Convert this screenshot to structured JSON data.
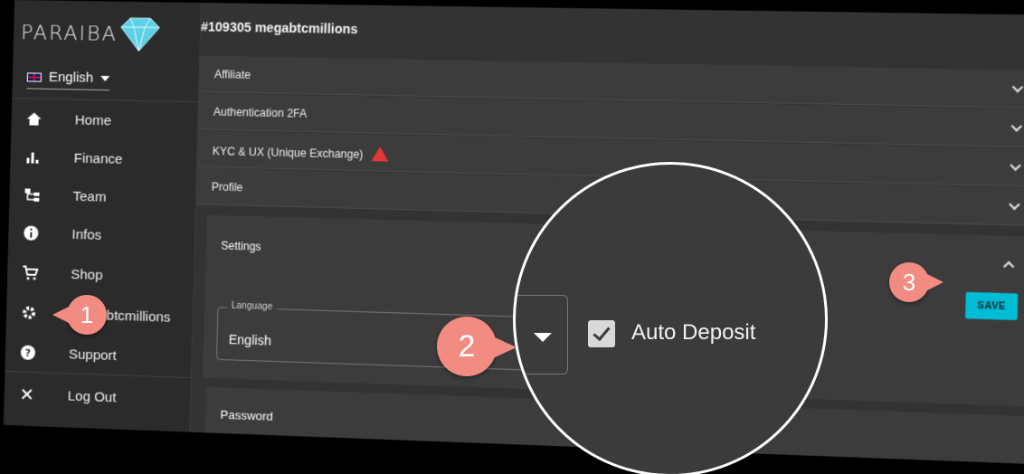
{
  "app": {
    "logo_text": "PARAIBA"
  },
  "language_selector": {
    "value": "English",
    "flag": "uk-flag-icon"
  },
  "user": {
    "title": "#109305 megabtcmillions"
  },
  "sidebar": {
    "items": [
      {
        "label": "Home",
        "icon": "home-icon"
      },
      {
        "label": "Finance",
        "icon": "bar-chart-icon"
      },
      {
        "label": "Team",
        "icon": "team-tree-icon"
      },
      {
        "label": "Infos",
        "icon": "info-icon"
      },
      {
        "label": "Shop",
        "icon": "cart-icon"
      },
      {
        "label": "abtcmillions",
        "icon": "gear-icon"
      },
      {
        "label": "Support",
        "icon": "help-icon"
      },
      {
        "label": "Log Out",
        "icon": "close-icon"
      }
    ]
  },
  "panels": [
    {
      "label": "Affiliate"
    },
    {
      "label": "Authentication 2FA"
    },
    {
      "label": "KYC & UX (Unique Exchange)"
    },
    {
      "label": "Profile"
    }
  ],
  "settings": {
    "title": "Settings",
    "save_label": "SAVE",
    "language_field": {
      "label": "Language",
      "value": "English"
    },
    "auto_deposit": {
      "label": "Auto Deposit",
      "checked": true
    }
  },
  "password_panel": {
    "label": "Password"
  },
  "markers": [
    "1",
    "2",
    "3"
  ],
  "colors": {
    "accent": "#00bcd4",
    "marker": "#f28b82",
    "warning": "#e53935"
  }
}
